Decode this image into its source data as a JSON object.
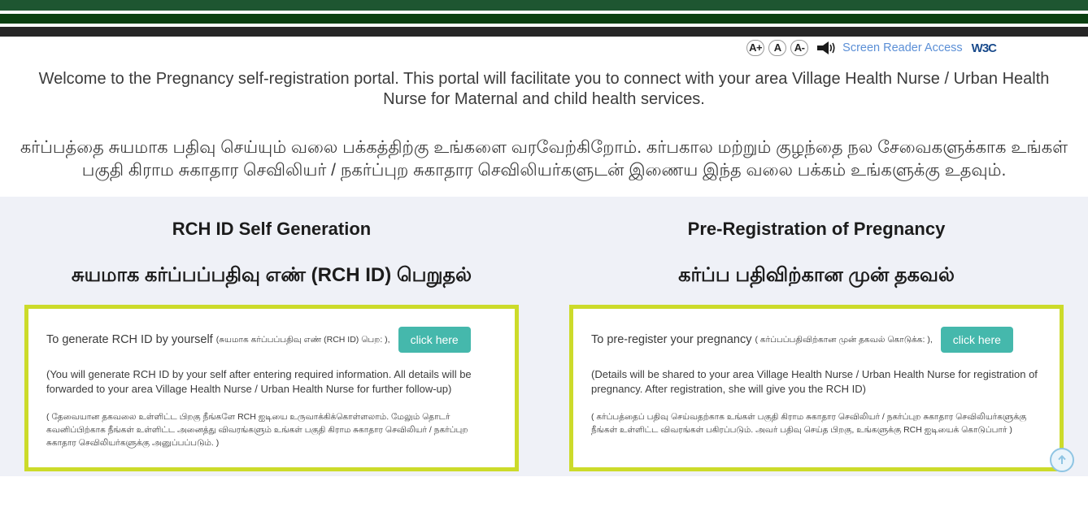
{
  "theme": {
    "band_green_light": "#1e5631",
    "band_green_dark": "#0b4012",
    "band_dark": "#262626",
    "section_bg": "#eff1f7",
    "card_border": "#ccdb2a",
    "button_teal": "#45b8ac",
    "link_blue": "#5b8fd6",
    "w3c_blue": "#1a4b8c",
    "scroll_top_border": "#8fc5e3"
  },
  "access_bar": {
    "increase_font_label": "A+",
    "normal_font_label": "A",
    "decrease_font_label": "A-",
    "speaker_icon": "speaker-icon",
    "screen_reader_label": "Screen Reader Access",
    "w3c_label": "W3C"
  },
  "welcome": {
    "english": "Welcome to the Pregnancy self-registration portal. This portal will facilitate you to connect with your area Village Health Nurse / Urban Health Nurse for Maternal and child health services.",
    "tamil": "கர்ப்பத்தை சுயமாக பதிவு செய்யும் வலை பக்கத்திற்கு உங்களை வரவேற்கிறோம். கர்பகால மற்றும் குழந்தை நல சேவைகளுக்காக உங்கள் பகுதி கிராம சுகாதார செவிலியர் / நகர்ப்புற சுகாதார செவிலியர்களுடன் இணைய இந்த வலை பக்கம் உங்களுக்கு உதவும்."
  },
  "cards": [
    {
      "title_en": "RCH ID Self Generation",
      "title_ta": "சுயமாக கர்ப்பப்பதிவு எண் (RCH ID) பெறுதல்",
      "lead_en": "To generate RCH ID by yourself",
      "lead_ta": "(சுயமாக கர்ப்பப்பதிவு எண் (RCH ID) பெற: ),",
      "button_label": "click here",
      "note_en": "(You will generate RCH ID by your self after entering required information. All details will be forwarded to your area Village Health Nurse / Urban Health Nurse for further follow-up)",
      "note_ta": "( தேவையான தகவலை உள்ளிட்ட பிறகு நீங்களே RCH ஐடியை உருவாக்கிக்கொள்ளலாம். மேலும் தொடர் கவனிப்பிற்காக நீங்கள் உள்ளிட்ட அனைத்து விவரங்களும் உங்கள் பகுதி கிராம சுகாதார செவிலியர் / நகர்ப்புற சுகாதார செவிலியர்களுக்கு அனுப்பப்படும். )"
    },
    {
      "title_en": "Pre-Registration of Pregnancy",
      "title_ta": "கர்ப்ப பதிவிற்கான முன் தகவல்",
      "lead_en": "To pre-register your pregnancy",
      "lead_ta": "( கர்ப்பப்பதிவிற்கான முன் தகவல் கொடுக்க: ),",
      "button_label": "click here",
      "note_en": "(Details will be shared to your area Village Health Nurse / Urban Health Nurse for registration of pregnancy. After registration, she will give you the RCH ID)",
      "note_ta": "( கர்ப்பத்தைப் பதிவு செய்வதற்காக உங்கள் பகுதி கிராம சுகாதார செவிலியர் / நகர்ப்புற சுகாதார செவிலியர்களுக்கு நீங்கள் உள்ளிட்ட விவரங்கள் பகிரப்படும். அவர் பதிவு செய்த பிறகு, உங்களுக்கு RCH ஐடியைக் கொடுப்பார் )"
    }
  ],
  "scroll_top": {
    "icon": "arrow-up-icon"
  }
}
